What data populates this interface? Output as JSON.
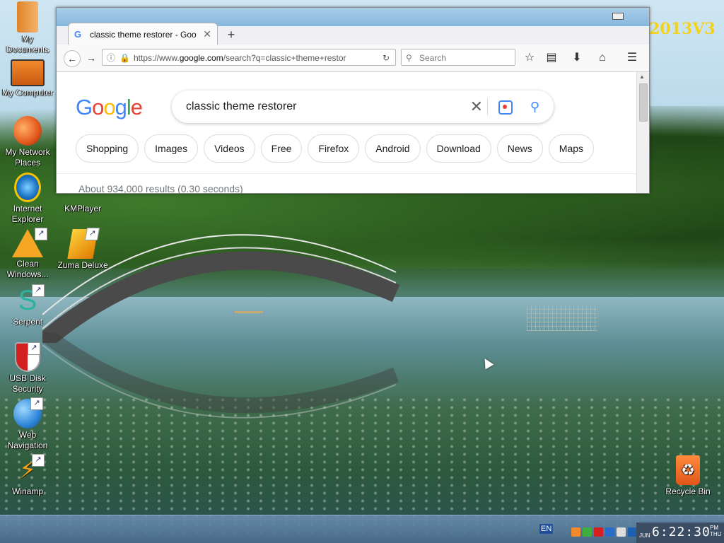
{
  "desktop": {
    "corner_text": "2013V3",
    "icons": [
      {
        "label": "My Documents"
      },
      {
        "label": "My Computer"
      },
      {
        "label": "My Network Places"
      },
      {
        "label": "Internet Explorer"
      },
      {
        "label": "KMPlayer"
      },
      {
        "label": "Clean Windows..."
      },
      {
        "label": "Zuma Deluxe"
      },
      {
        "label": "Serpent"
      },
      {
        "label": "USB Disk Security"
      },
      {
        "label": "Web Navigation"
      },
      {
        "label": "Winamp"
      },
      {
        "label": "Recycle Bin"
      }
    ]
  },
  "browser": {
    "tab_title": "classic theme restorer - Goo",
    "url_prefix": "https://www.",
    "url_domain": "google.com",
    "url_rest": "/search?q=classic+theme+restor",
    "search_placeholder": "Search",
    "google": {
      "query": "classic theme restorer",
      "chips": [
        "Shopping",
        "Images",
        "Videos",
        "Free",
        "Firefox",
        "Android",
        "Download",
        "News",
        "Maps"
      ],
      "results_text": "About 934,000 results (0.30 seconds)"
    }
  },
  "taskbar": {
    "language": "EN",
    "month": "JUN",
    "time": "6:22:30",
    "day": "THU",
    "period": "PM"
  },
  "colors": {
    "google_blue": "#4285f4",
    "google_red": "#ea4335",
    "google_yellow": "#fbbc05",
    "google_green": "#34a853",
    "corner_text": "#f2d21d"
  }
}
